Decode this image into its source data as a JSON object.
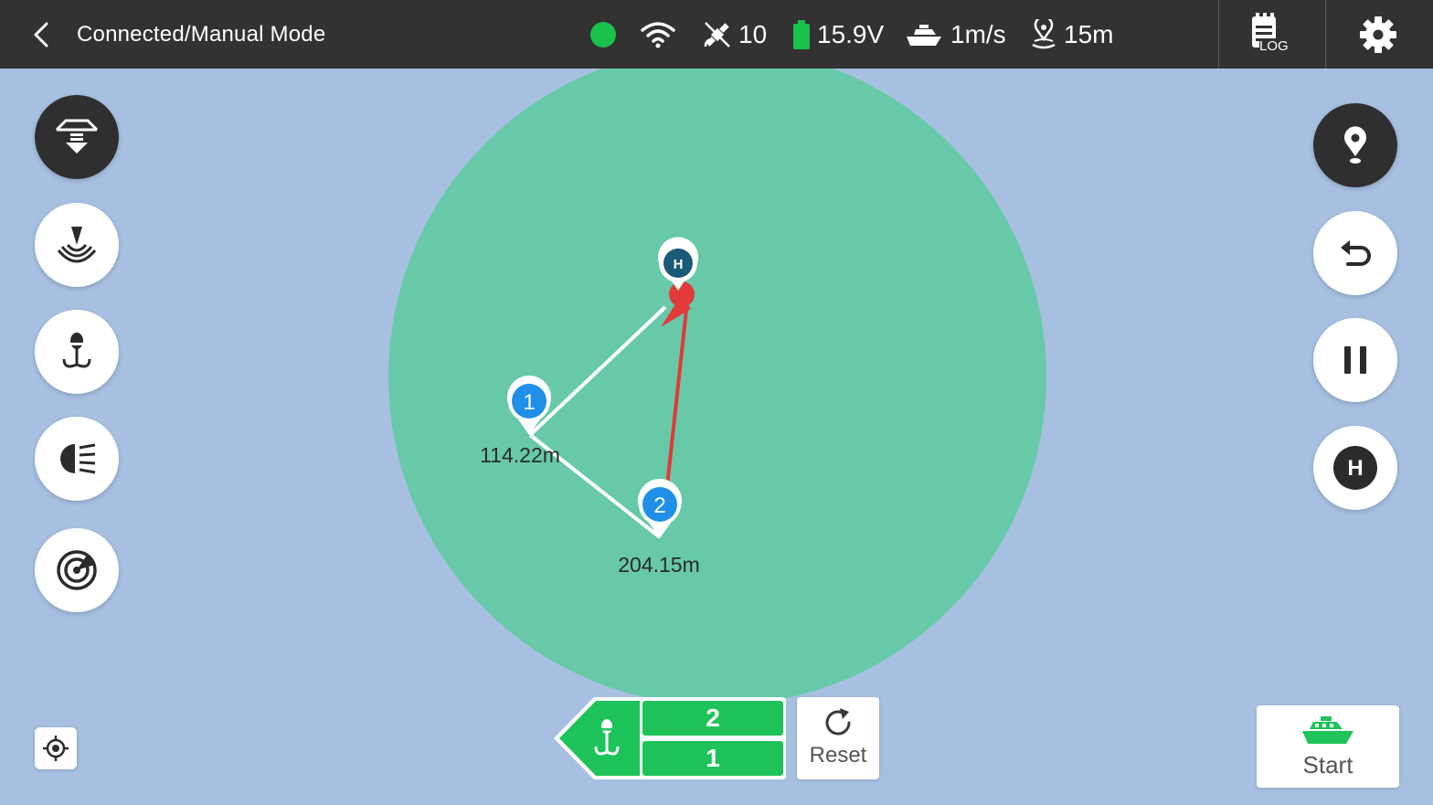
{
  "header": {
    "title": "Connected/Manual Mode",
    "satellites": "10",
    "voltage": "15.9V",
    "speed": "1m/s",
    "distance": "15m",
    "log_label": "LOG"
  },
  "map": {
    "waypoints": [
      {
        "label": "1",
        "distance": "114.22m"
      },
      {
        "label": "2",
        "distance": "204.15m"
      }
    ],
    "home_label": "H"
  },
  "right_controls": {
    "home_label": "H"
  },
  "bottom": {
    "count_top": "2",
    "count_bottom": "1",
    "reset_label": "Reset",
    "start_label": "Start"
  },
  "colors": {
    "top_bar": "#323232",
    "water": "#a7c0e2",
    "range_circle": "#67c9a8",
    "accent_green": "#1ec35a",
    "waypoint_blue": "#1f8fe8",
    "route_red": "#e03a3a",
    "home_marker": "#1b5a77"
  },
  "icons": [
    "back-icon",
    "wifi-icon",
    "satellite-icon",
    "battery-icon",
    "boat-speed-icon",
    "location-distance-icon",
    "log-icon",
    "gear-icon",
    "bait-drop-icon",
    "sonar-icon",
    "hook-icon",
    "headlight-icon",
    "radar-icon",
    "locate-icon",
    "map-pin-icon",
    "undo-icon",
    "pause-icon",
    "home-icon",
    "reset-icon",
    "boat-icon"
  ]
}
